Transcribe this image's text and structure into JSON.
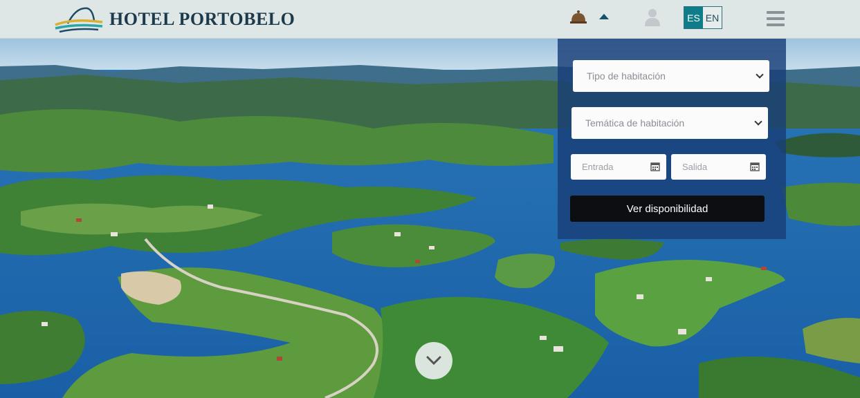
{
  "header": {
    "brand": "HOTEL PORTOBELO",
    "icons": [
      "bell-icon",
      "caret-up-icon",
      "user-icon",
      "menu-icon"
    ],
    "languages": [
      {
        "code": "ES",
        "active": true
      },
      {
        "code": "EN",
        "active": false
      }
    ]
  },
  "booking": {
    "room_type_placeholder": "Tipo de habitación",
    "room_theme_placeholder": "Temática de habitación",
    "checkin_placeholder": "Entrada",
    "checkout_placeholder": "Salida",
    "submit_label": "Ver disponibilidad"
  },
  "hero": {
    "scroll_icon": "chevron-down-icon"
  },
  "colors": {
    "header_bg": "#dfe6e6",
    "brand": "#1d3a4c",
    "lang_active": "#0f7c8a",
    "panel_bg": "#183e78",
    "button_bg": "#0c0e12"
  }
}
